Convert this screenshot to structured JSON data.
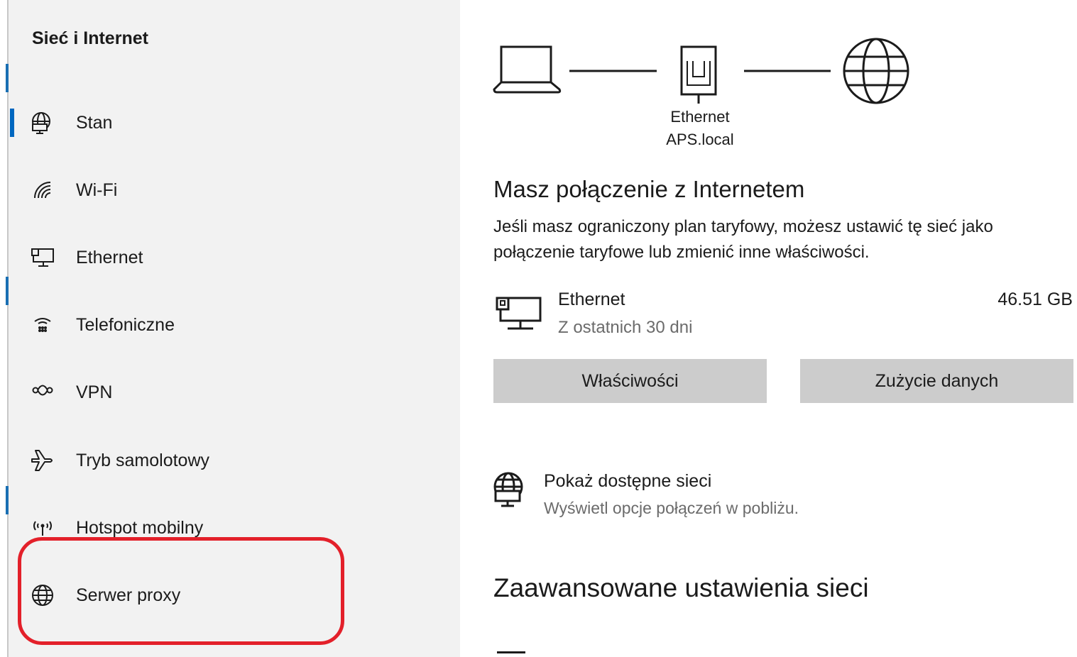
{
  "nav": {
    "title": "Sieć i Internet",
    "items": [
      {
        "label": "Stan",
        "icon": "globe-monitor-icon",
        "selected": true
      },
      {
        "label": "Wi-Fi",
        "icon": "wifi-icon"
      },
      {
        "label": "Ethernet",
        "icon": "ethernet-icon"
      },
      {
        "label": "Telefoniczne",
        "icon": "dialup-icon"
      },
      {
        "label": "VPN",
        "icon": "vpn-icon"
      },
      {
        "label": "Tryb samolotowy",
        "icon": "airplane-icon"
      },
      {
        "label": "Hotspot mobilny",
        "icon": "hotspot-icon"
      },
      {
        "label": "Serwer proxy",
        "icon": "globe-icon"
      }
    ]
  },
  "diagram": {
    "adapter_name": "Ethernet",
    "network_name": "APS.local"
  },
  "status": {
    "heading": "Masz połączenie z Internetem",
    "description": "Jeśli masz ograniczony plan taryfowy, możesz ustawić tę sieć jako połączenie taryfowe lub zmienić inne właściwości."
  },
  "connection": {
    "name": "Ethernet",
    "period": "Z ostatnich 30 dni",
    "data_used": "46.51 GB"
  },
  "buttons": {
    "properties": "Właściwości",
    "data_usage": "Zużycie danych"
  },
  "show_networks": {
    "title": "Pokaż dostępne sieci",
    "subtitle": "Wyświetl opcje połączeń w pobliżu."
  },
  "advanced": {
    "heading": "Zaawansowane ustawienia sieci"
  },
  "colors": {
    "accent": "#0067c0",
    "highlight": "#e3202a",
    "button_bg": "#cccccc",
    "nav_bg": "#f2f2f2"
  }
}
